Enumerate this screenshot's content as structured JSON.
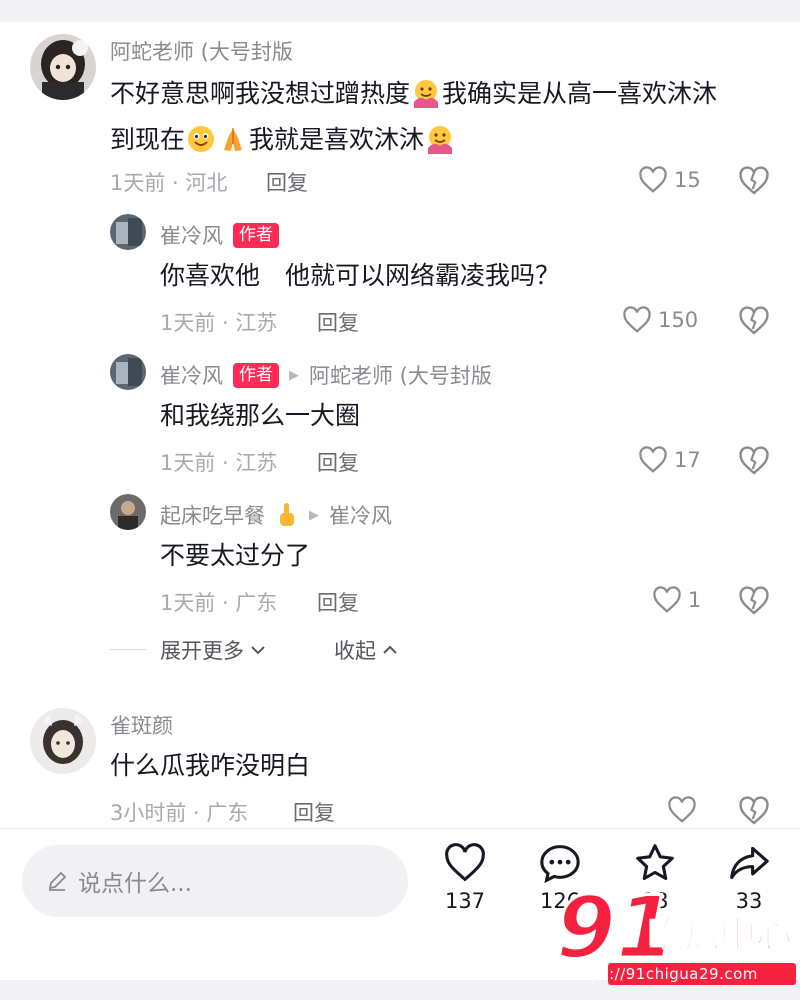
{
  "comments": [
    {
      "username": "阿蛇老师 (大号封版",
      "text_parts": [
        "不好意思啊我没想过蹭热度",
        "我确实是从高一喜欢沐沐",
        "到现在",
        "我就是喜欢沐沐"
      ],
      "time_location": "1天前 · 河北",
      "reply_label": "回复",
      "likes": "15"
    },
    {
      "username": "崔冷风",
      "badge": "作者",
      "text": "你喜欢他　他就可以网络霸凌我吗？",
      "time_location": "1天前 · 江苏",
      "reply_label": "回复",
      "likes": "150"
    },
    {
      "username": "崔冷风",
      "badge": "作者",
      "reply_to": "阿蛇老师 (大号封版",
      "text": "和我绕那么一大圈",
      "time_location": "1天前 · 江苏",
      "reply_label": "回复",
      "likes": "17"
    },
    {
      "username": "起床吃早餐",
      "reply_to": "崔冷风",
      "text": "不要太过分了",
      "time_location": "1天前 · 广东",
      "reply_label": "回复",
      "likes": "1"
    },
    {
      "username": "雀斑颜",
      "text": "什么瓜我咋没明白",
      "time_location": "3小时前 · 广东",
      "reply_label": "回复",
      "likes": ""
    }
  ],
  "thread_controls": {
    "expand_more": "展开更多",
    "collapse": "收起"
  },
  "bottom_bar": {
    "input_placeholder": "说点什么...",
    "like_count": "137",
    "comment_count": "126",
    "favorite_count": "18",
    "share_count": "33"
  },
  "watermark": {
    "logo_number": "91",
    "logo_text": "吃瓜中心",
    "url": "https://91chigua29.com"
  },
  "colors": {
    "author_badge": "#fe2c55",
    "watermark_red": "#f6203f"
  }
}
